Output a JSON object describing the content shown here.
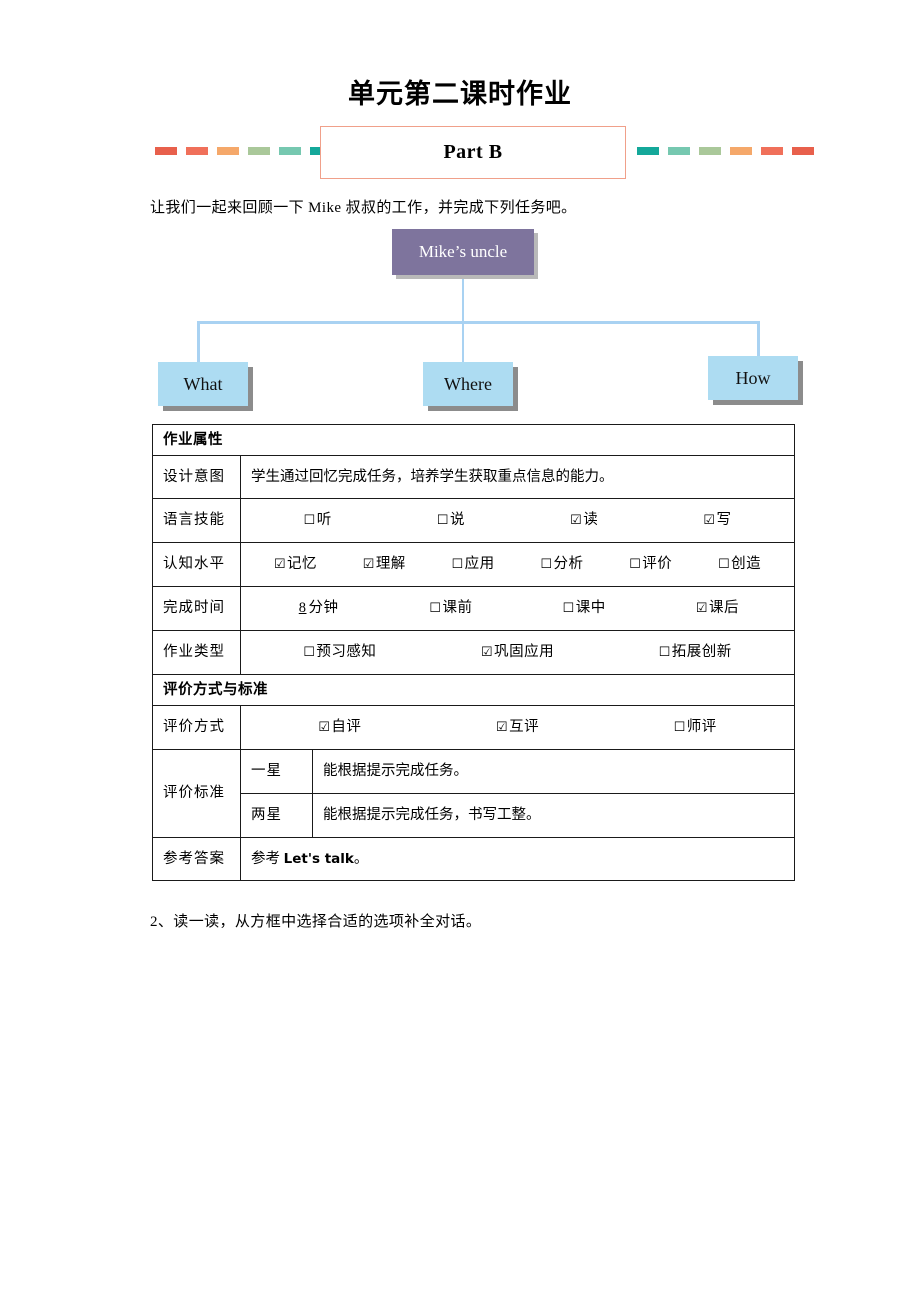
{
  "document": {
    "title": "单元第二课时作业",
    "banner": {
      "label": "Part B",
      "border_color": "#f0a08a",
      "dashes_left": [
        "#e8604c",
        "#f0705a",
        "#f5a86a",
        "#aac89a",
        "#76c8b0",
        "#14a89a"
      ],
      "dashes_right": [
        "#14a89a",
        "#76c8b0",
        "#aac89a",
        "#f5a86a",
        "#f0705a",
        "#e8604c"
      ]
    },
    "intro_line": "让我们一起来回顾一下 Mike 叔叔的工作，并完成下列任务吧。",
    "bottom_line": "2、读一读，从方框中选择合适的选项补全对话。"
  },
  "diagram": {
    "root": {
      "label": "Mike’s uncle",
      "fill": "#7e749d",
      "text_color": "#ffffff"
    },
    "leaves": [
      {
        "label": "What",
        "fill": "#addcf2"
      },
      {
        "label": "Where",
        "fill": "#addcf2"
      },
      {
        "label": "How",
        "fill": "#addcf2"
      }
    ],
    "connector_color": "#a9d2f2",
    "shadow_color": "#8c8c8c"
  },
  "table": {
    "section_1_title": "作业属性",
    "rows": {
      "design_intent": {
        "label": "设计意图",
        "value": "学生通过回忆完成任务，培养学生获取重点信息的能力。"
      },
      "language_skills": {
        "label": "语言技能",
        "options": [
          {
            "text": "听",
            "checked": false
          },
          {
            "text": "说",
            "checked": false
          },
          {
            "text": "读",
            "checked": true
          },
          {
            "text": "写",
            "checked": true
          }
        ]
      },
      "cognitive_level": {
        "label": "认知水平",
        "options": [
          {
            "text": "记忆",
            "checked": true
          },
          {
            "text": "理解",
            "checked": true
          },
          {
            "text": "应用",
            "checked": false
          },
          {
            "text": "分析",
            "checked": false
          },
          {
            "text": "评价",
            "checked": false
          },
          {
            "text": "创造",
            "checked": false
          }
        ]
      },
      "completion_time": {
        "label": "完成时间",
        "minutes_value": "8",
        "minutes_unit": "分钟",
        "options": [
          {
            "text": "课前",
            "checked": false
          },
          {
            "text": "课中",
            "checked": false
          },
          {
            "text": "课后",
            "checked": true
          }
        ]
      },
      "homework_type": {
        "label": "作业类型",
        "options": [
          {
            "text": "预习感知",
            "checked": false
          },
          {
            "text": "巩固应用",
            "checked": true
          },
          {
            "text": "拓展创新",
            "checked": false
          }
        ]
      }
    },
    "section_2_title": "评价方式与标准",
    "eval": {
      "method": {
        "label": "评价方式",
        "options": [
          {
            "text": "自评",
            "checked": true
          },
          {
            "text": "互评",
            "checked": true
          },
          {
            "text": "师评",
            "checked": false
          }
        ]
      },
      "criteria": {
        "label": "评价标准",
        "items": [
          {
            "star": "一星",
            "text": "能根据提示完成任务。"
          },
          {
            "star": "两星",
            "text": "能根据提示完成任务，书写工整。"
          }
        ]
      },
      "reference_answer": {
        "label": "参考答案",
        "prefix": "参考 ",
        "english": "Let's talk",
        "suffix": "。"
      }
    }
  },
  "glyphs": {
    "checked": "☑",
    "unchecked": "☐"
  }
}
